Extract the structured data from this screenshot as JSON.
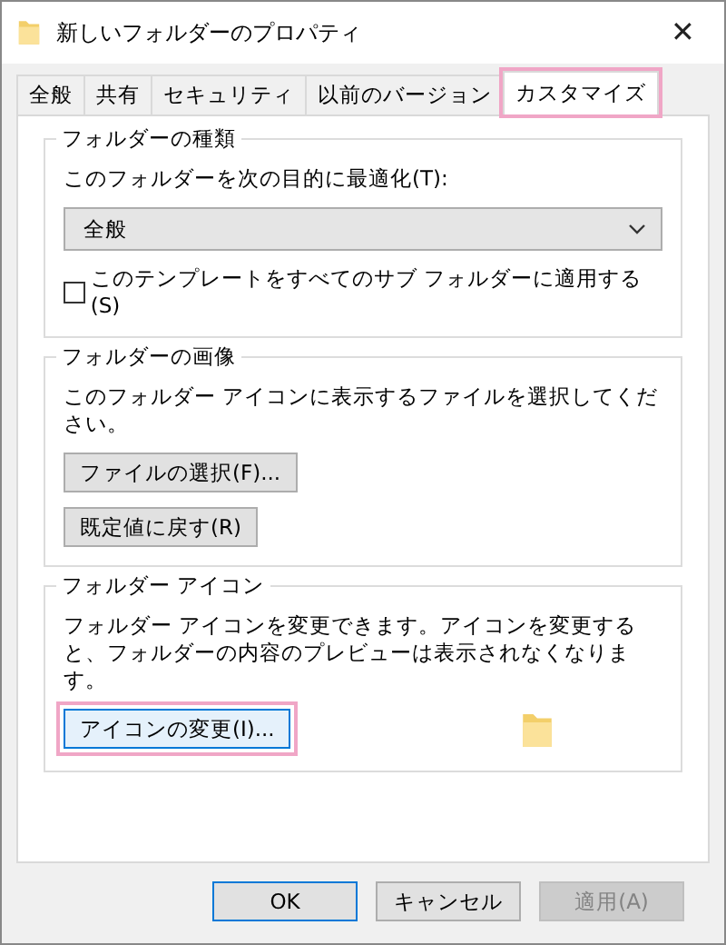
{
  "window": {
    "title": "新しいフォルダーのプロパティ",
    "close": "✕"
  },
  "tabs": [
    {
      "label": "全般",
      "selected": false,
      "highlighted": false
    },
    {
      "label": "共有",
      "selected": false,
      "highlighted": false
    },
    {
      "label": "セキュリティ",
      "selected": false,
      "highlighted": false
    },
    {
      "label": "以前のバージョン",
      "selected": false,
      "highlighted": false
    },
    {
      "label": "カスタマイズ",
      "selected": true,
      "highlighted": true
    }
  ],
  "folder_type": {
    "title": "フォルダーの種類",
    "label": "このフォルダーを次の目的に最適化(T):",
    "dropdown": {
      "value": "全般"
    },
    "apply_template": {
      "label": "このテンプレートをすべてのサブ フォルダーに適用する(S)",
      "checked": false
    }
  },
  "folder_picture": {
    "title": "フォルダーの画像",
    "description": "このフォルダー アイコンに表示するファイルを選択してください。",
    "buttons": [
      {
        "label": "ファイルの選択(F)..."
      },
      {
        "label": "既定値に戻す(R)"
      }
    ]
  },
  "folder_icon": {
    "title": "フォルダー アイコン",
    "description": "フォルダー アイコンを変更できます。アイコンを変更すると、フォルダーの内容のプレビューは表示されなくなります。",
    "button": {
      "label": "アイコンの変更(I)...",
      "highlighted": true
    }
  },
  "footer_buttons": [
    {
      "label": "OK",
      "kind": "default",
      "disabled": false
    },
    {
      "label": "キャンセル",
      "kind": "normal",
      "disabled": false
    },
    {
      "label": "適用(A)",
      "kind": "normal",
      "disabled": true
    }
  ]
}
